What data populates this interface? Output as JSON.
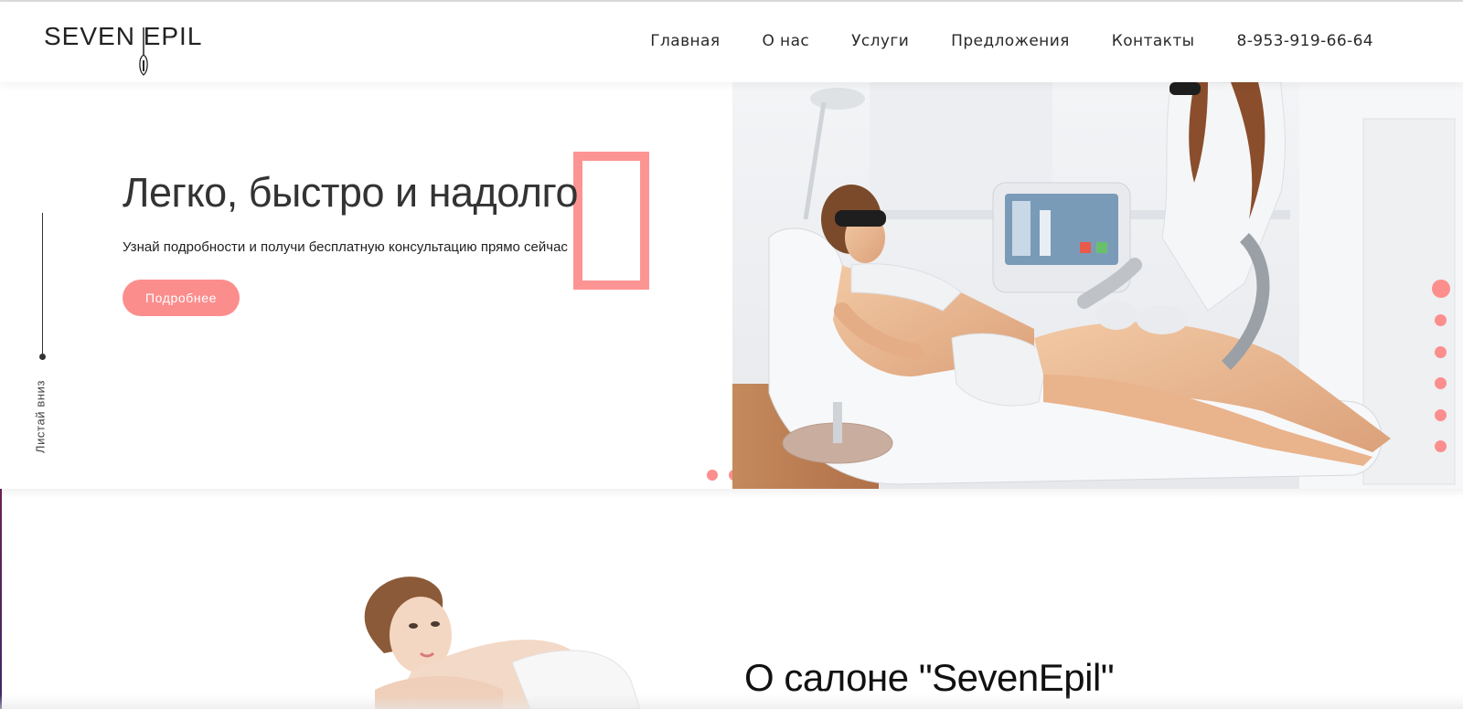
{
  "header": {
    "logo_text": "SEVEN EPIL",
    "nav": [
      "Главная",
      "О нас",
      "Услуги",
      "Предложения",
      "Контакты"
    ],
    "phone": "8-953-919-66-64"
  },
  "hero": {
    "title": "Легко, быстро и надолго",
    "subtitle": "Узнай подробности и получи бесплатную консультацию прямо сейчас",
    "button_label": "Подробнее",
    "scroll_label": "Листай вниз",
    "slider_active_index": 2,
    "slider_count": 2
  },
  "section_nav": {
    "count": 6,
    "active_index": 1
  },
  "about": {
    "title": "О салоне \"SevenEpil\""
  },
  "colors": {
    "accent": "#fd8e8e",
    "text": "#333333"
  }
}
